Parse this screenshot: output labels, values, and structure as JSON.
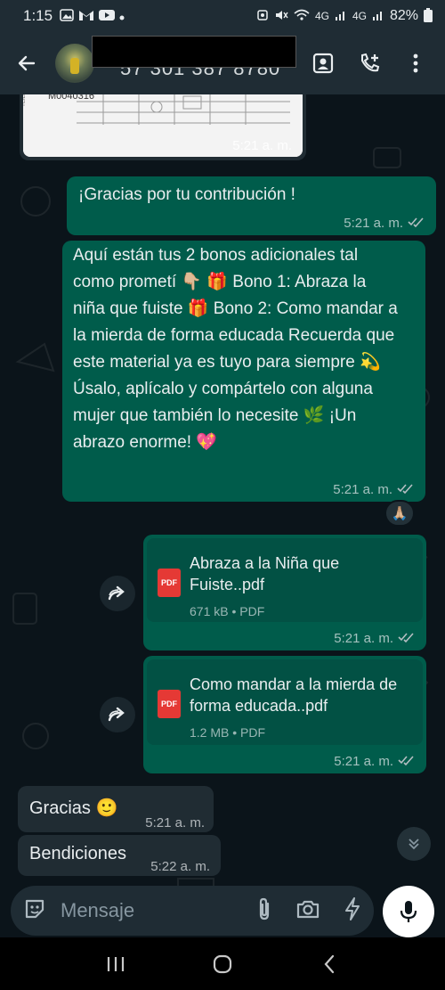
{
  "status_bar": {
    "time": "1:15",
    "battery": "82%",
    "network_1": "4G",
    "network_2": "4G"
  },
  "header": {
    "contact_sub": "57 301 387 8780"
  },
  "messages": {
    "image_time": "5:21 a. m.",
    "image_code": "M0040316",
    "thanks_text": "¡Gracias por tu contribución !",
    "thanks_time": "5:21 a. m.",
    "bonus_text": "Aquí están tus 2 bonos adicionales tal como prometí 👇🏼 🎁 Bono 1: Abraza la niña que fuiste 🎁 Bono 2: Como mandar a la mierda de forma educada Recuerda que este material ya es tuyo para siempre 💫 Úsalo, aplícalo y compártelo con alguna mujer que también lo necesite 🌿 ¡Un abrazo enorme! 💖",
    "bonus_time": "5:21 a. m.",
    "reaction_emoji": "🙏🏼",
    "doc1_title": "Abraza a la Niña que Fuiste..pdf",
    "doc1_info": "671 kB • PDF",
    "doc1_time": "5:21 a. m.",
    "doc2_title": "Como mandar a la mierda de forma educada..pdf",
    "doc2_info": "1.2 MB • PDF",
    "doc2_time": "5:21 a. m.",
    "in1_text": "Gracias 🙂",
    "in1_time": "5:21 a. m.",
    "in2_text": "Bendiciones",
    "in2_time": "5:22 a. m.",
    "pdf_label": "PDF"
  },
  "input": {
    "placeholder": "Mensaje"
  },
  "colors": {
    "outgoing_bubble": "#005c4b",
    "incoming_bubble": "#202c33",
    "background": "#0b141a",
    "pdf_red": "#e53935"
  }
}
